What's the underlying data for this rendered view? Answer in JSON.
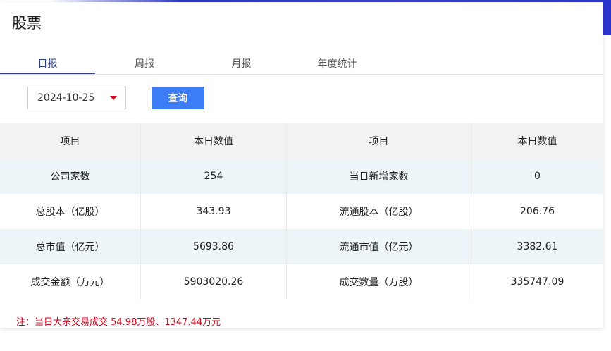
{
  "page": {
    "title": "股票"
  },
  "tabs": [
    {
      "label": "日报",
      "active": true
    },
    {
      "label": "周报",
      "active": false
    },
    {
      "label": "月报",
      "active": false
    },
    {
      "label": "年度统计",
      "active": false
    }
  ],
  "filter": {
    "date": "2024-10-25",
    "query_label": "查询"
  },
  "table": {
    "headers": [
      "项目",
      "本日数值",
      "项目",
      "本日数值"
    ],
    "rows": [
      [
        "公司家数",
        "254",
        "当日新增家数",
        "0"
      ],
      [
        "总股本（亿股）",
        "343.93",
        "流通股本（亿股）",
        "206.76"
      ],
      [
        "总市值（亿元）",
        "5693.86",
        "流通市值（亿元）",
        "3382.61"
      ],
      [
        "成交金额（万元）",
        "5903020.26",
        "成交数量（万股）",
        "335747.09"
      ]
    ]
  },
  "note": "注：当日大宗交易成交 54.98万股、1347.44万元",
  "colors": {
    "accent": "#3d7cf7",
    "tab_active": "#2c3e7a",
    "note": "#d0021b",
    "row_alt": "#eef5f9"
  }
}
